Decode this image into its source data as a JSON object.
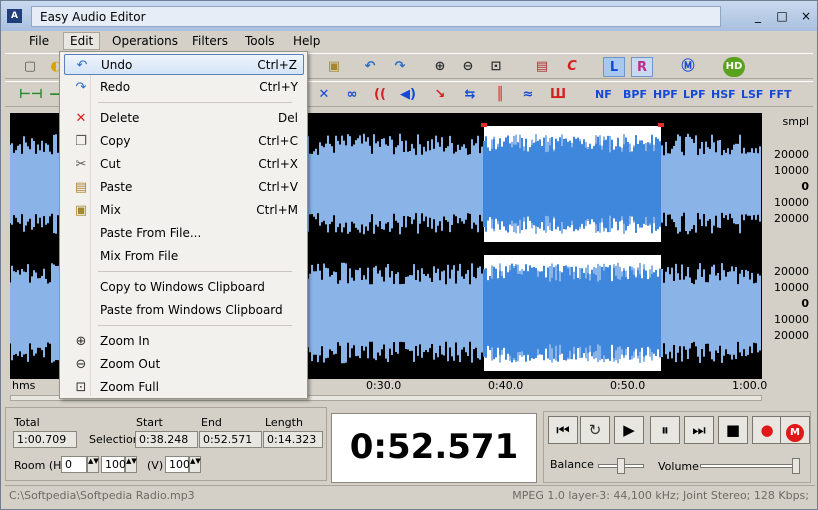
{
  "window": {
    "title": "Easy Audio Editor"
  },
  "window_controls": [
    "_",
    "□",
    "×"
  ],
  "menubar": [
    {
      "label": "File"
    },
    {
      "label": "Edit"
    },
    {
      "label": "Operations"
    },
    {
      "label": "Filters"
    },
    {
      "label": "Tools"
    },
    {
      "label": "Help"
    }
  ],
  "toolbar": {
    "channel_left": "L",
    "channel_right": "R",
    "filters": [
      "NF",
      "BPF",
      "HPF",
      "LPF",
      "HSF",
      "LSF",
      "FFT"
    ]
  },
  "edit_menu": {
    "items": [
      {
        "label": "Undo",
        "shortcut": "Ctrl+Z",
        "icon": "undo-icon"
      },
      {
        "label": "Redo",
        "shortcut": "Ctrl+Y",
        "icon": "redo-icon"
      },
      {
        "label": "Delete",
        "shortcut": "Del",
        "icon": "delete-icon"
      },
      {
        "label": "Copy",
        "shortcut": "Ctrl+C",
        "icon": "copy-icon"
      },
      {
        "label": "Cut",
        "shortcut": "Ctrl+X",
        "icon": "cut-icon"
      },
      {
        "label": "Paste",
        "shortcut": "Ctrl+V",
        "icon": "paste-icon"
      },
      {
        "label": "Mix",
        "shortcut": "Ctrl+M",
        "icon": "mix-icon"
      },
      {
        "label": "Paste From File...",
        "shortcut": ""
      },
      {
        "label": "Mix From File",
        "shortcut": ""
      },
      {
        "label": "Copy to Windows Clipboard",
        "shortcut": ""
      },
      {
        "label": "Paste from Windows Clipboard",
        "shortcut": ""
      },
      {
        "label": "Zoom In",
        "shortcut": "",
        "icon": "zoom-in-icon"
      },
      {
        "label": "Zoom Out",
        "shortcut": "",
        "icon": "zoom-out-icon"
      },
      {
        "label": "Zoom Full",
        "shortcut": "",
        "icon": "zoom-full-icon"
      }
    ]
  },
  "waveform": {
    "scale_unit": "smpl",
    "scale_top": [
      "20000",
      "10000",
      "0",
      "10000",
      "20000"
    ],
    "scale_bottom": [
      "20000",
      "10000",
      "0",
      "10000",
      "20000"
    ],
    "time_unit": "hms",
    "time_ticks": [
      "0:30.0",
      "0:40.0",
      "0:50.0",
      "1:00.0"
    ],
    "selection": {
      "start": 38.248,
      "end": 52.571,
      "total": 60.709
    },
    "colors": {
      "wave": "#8ab4e8",
      "selected_wave": "#3f86dd",
      "selection_bg": "#ffffff",
      "background": "#000000",
      "marker": "#e0302a"
    }
  },
  "info": {
    "total_label": "Total",
    "total_value": "1:00.709",
    "start_label": "Start",
    "end_label": "End",
    "length_label": "Length",
    "selection_label": "Selection",
    "start_value": "0:38.248",
    "end_value": "0:52.571",
    "length_value": "0:14.323",
    "room_h_label": "Room (H)",
    "room_h_value": "0",
    "room_h_value2": "100",
    "room_v_label": "(V)",
    "room_v_value": "100"
  },
  "time_display": "0:52.571",
  "transport": {
    "balance_label": "Balance",
    "volume_label": "Volume",
    "balance_level": 0.5,
    "volume_level": 1.0
  },
  "status": {
    "file_path": "C:\\Softpedia\\Softpedia Radio.mp3",
    "format": "MPEG 1.0 layer-3: 44,100 kHz; Joint Stereo; 128 Kbps;"
  }
}
